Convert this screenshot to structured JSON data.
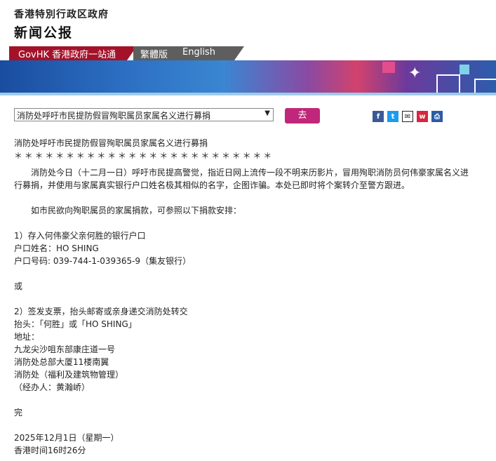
{
  "header": {
    "gov_name": "香港特別行政区政府",
    "press_title": "新闻公报"
  },
  "nav": {
    "govhk_link": "GovHK 香港政府一站通",
    "traditional_link": "繁體版",
    "english_link": "English"
  },
  "controls": {
    "selected_topic": "消防处呼吁市民提防假冒殉职属员家属名义进行募捐",
    "go_label": "去"
  },
  "share_icons": [
    "facebook-icon",
    "twitter-icon",
    "email-icon",
    "weibo-icon",
    "print-icon"
  ],
  "colors": {
    "nav_red": "#a4122a",
    "go_button": "#c0277a"
  },
  "article": {
    "headline": "消防处呼吁市民提防假冒殉职属员家属名义进行募捐",
    "separator": "＊＊＊＊＊＊＊＊＊＊＊＊＊＊＊＊＊＊＊＊＊＊＊＊＊",
    "para1": "消防处今日（十二月一日）呼吁市民提高警觉，指近日网上流传一段不明来历影片，冒用殉职消防员何伟豪家属名义进行募捐，并使用与家属真实银行户口姓名极其相似的名字，企图诈骗。本处已即时将个案转介至警方跟进。",
    "para2": "如市民欲向殉职属员的家属捐款，可参照以下捐款安排：",
    "option1_title": "1）存入何伟豪父亲何胜的银行户口",
    "option1_name": "户口姓名：HO SHING",
    "option1_account": "户口号码: 039-744-1-039365-9（集友银行）",
    "or_text": "或",
    "option2_title": "2）签发支票，抬头邮寄或亲身递交消防处转交",
    "option2_payee": "抬头：「何胜」或「HO SHING」",
    "option2_address_label": "地址：",
    "address_line1": "九龙尖沙咀东部康庄道一号",
    "address_line2": "消防处总部大厦11楼南翼",
    "address_line3": "消防处（福利及建筑物管理）",
    "address_line4": "（经办人：黄瀚峤）",
    "end_text": "完",
    "date_line": "2025年12月1日（星期一）",
    "time_line": "香港时间16时26分"
  }
}
